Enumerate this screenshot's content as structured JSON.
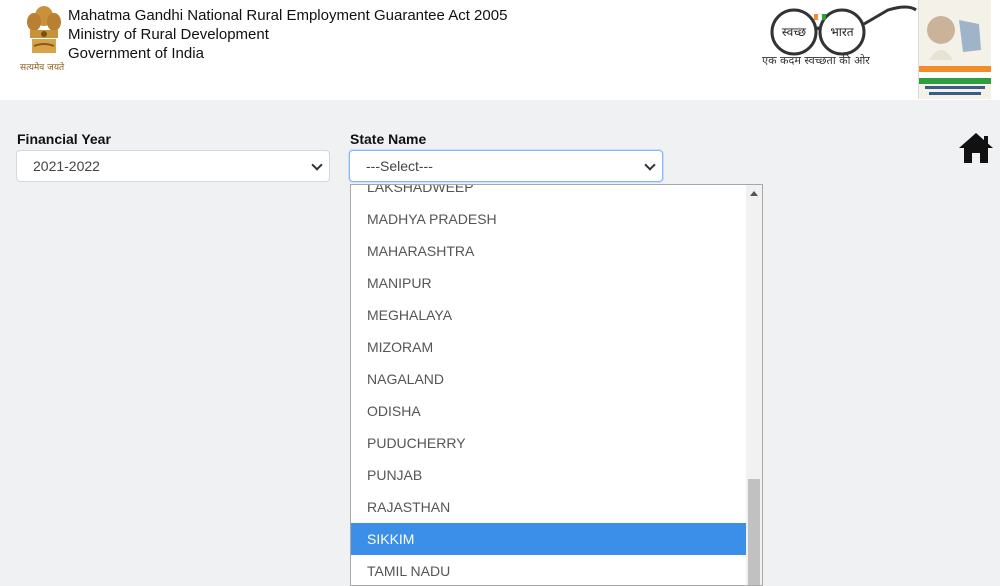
{
  "header": {
    "title_line1": "Mahatma Gandhi National Rural Employment Guarantee Act 2005",
    "title_line2": "Ministry of Rural Development",
    "title_line3": "Government of India",
    "emblem_caption": "सत्यमेव जयते",
    "swachh_word1": "स्वच्छ",
    "swachh_word2": "भारत",
    "swachh_tagline": "एक कदम स्वच्छता की ओर"
  },
  "form": {
    "financial_year_label": "Financial Year",
    "financial_year_value": "2021-2022",
    "state_label": "State Name",
    "state_value": "---Select---"
  },
  "dropdown": {
    "options": [
      "LAKSHADWEEP",
      "MADHYA PRADESH",
      "MAHARASHTRA",
      "MANIPUR",
      "MEGHALAYA",
      "MIZORAM",
      "NAGALAND",
      "ODISHA",
      "PUDUCHERRY",
      "PUNJAB",
      "RAJASTHAN",
      "SIKKIM",
      "TAMIL NADU"
    ],
    "highlighted": "SIKKIM"
  },
  "icons": {
    "home": "home-icon",
    "emblem": "national-emblem-icon",
    "swachh": "swachh-bharat-logo",
    "gandhi": "gandhi-portrait"
  },
  "colors": {
    "highlight": "#3b8fe8",
    "page_bg": "#eff1f3",
    "focus_border": "#86b7fe"
  }
}
